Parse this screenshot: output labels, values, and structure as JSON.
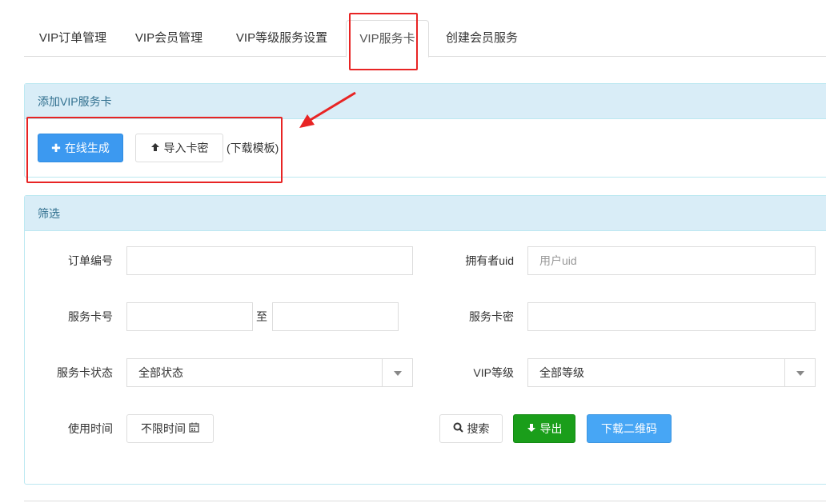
{
  "tabs": [
    {
      "label": "VIP订单管理"
    },
    {
      "label": "VIP会员管理"
    },
    {
      "label": "VIP等级服务设置"
    },
    {
      "label": "VIP服务卡"
    },
    {
      "label": "创建会员服务"
    }
  ],
  "add_panel": {
    "title": "添加VIP服务卡",
    "generate_label": "在线生成",
    "generate_icon": "plus-icon",
    "import_label": "导入卡密",
    "import_icon": "arrow-up-icon",
    "template_link": "(下载模板)"
  },
  "filter_panel": {
    "title": "筛选",
    "order_no_label": "订单编号",
    "order_no_value": "",
    "owner_uid_label": "拥有者uid",
    "owner_uid_placeholder": "用户uid",
    "card_no_label": "服务卡号",
    "card_no_from": "",
    "range_sep": "至",
    "card_no_to": "",
    "card_secret_label": "服务卡密",
    "card_secret_value": "",
    "status_label": "服务卡状态",
    "status_value": "全部状态",
    "vip_level_label": "VIP等级",
    "vip_level_value": "全部等级",
    "use_time_label": "使用时间",
    "use_time_value": "不限时间",
    "search_label": "搜索",
    "export_label": "导出",
    "download_qr_label": "下载二维码"
  },
  "colors": {
    "primary": "#3c99f0",
    "success": "#1a9e1a",
    "panel_heading_bg": "#d9edf7",
    "annotation": "#e82424"
  }
}
